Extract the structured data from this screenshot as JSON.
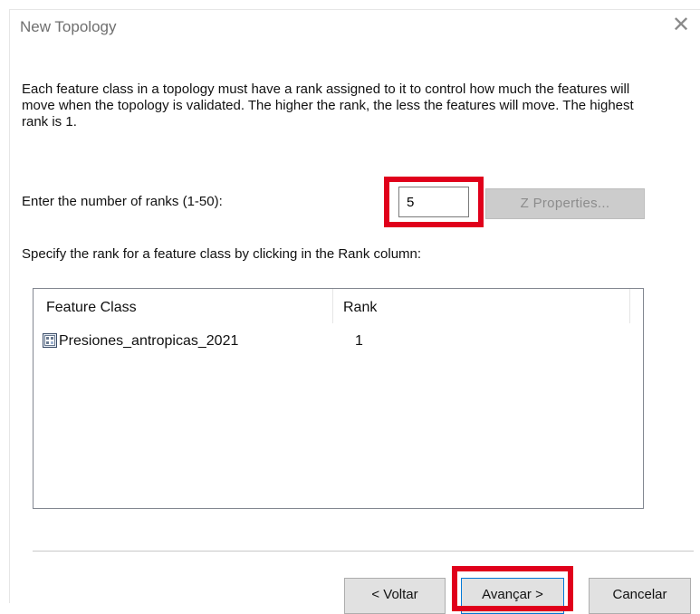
{
  "window": {
    "title": "New Topology",
    "close_symbol": "✕"
  },
  "description": "Each feature class in a topology must have a rank assigned to it to control how much the features will move when the topology is validated. The higher the rank, the less the features will move. The highest rank is 1.",
  "ranks": {
    "label": "Enter the number of ranks  (1-50):",
    "value": "5",
    "z_properties_label": "Z Properties..."
  },
  "specify_label": "Specify the rank for a feature class by clicking in the Rank column:",
  "table": {
    "columns": [
      "Feature Class",
      "Rank"
    ],
    "rows": [
      {
        "feature_class": "Presiones_antropicas_2021",
        "rank": "1",
        "icon": "polygon-feature-class-icon"
      }
    ]
  },
  "buttons": {
    "back": "< Voltar",
    "next": "Avançar >",
    "cancel": "Cancelar"
  },
  "colors": {
    "highlight": "#e0001b",
    "disabled_button": "#cccccc",
    "focus_border": "#0078d7"
  }
}
